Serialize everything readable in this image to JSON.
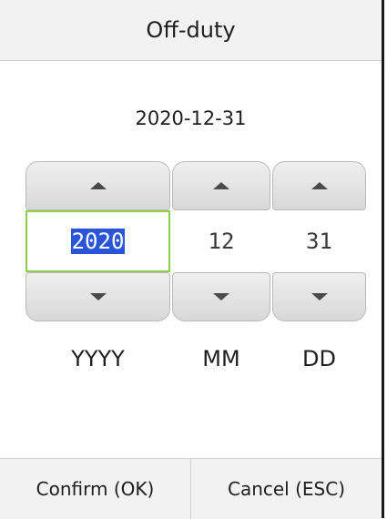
{
  "dialog": {
    "title": "Off-duty",
    "date_readout": "2020-12-31"
  },
  "picker": {
    "year": {
      "value": "2020",
      "label": "YYYY",
      "selected": true
    },
    "month": {
      "value": "12",
      "label": "MM"
    },
    "day": {
      "value": "31",
      "label": "DD"
    }
  },
  "footer": {
    "confirm_label": "Confirm (OK)",
    "cancel_label": "Cancel (ESC)"
  },
  "icons": {
    "up": "triangle-up-icon",
    "down": "triangle-down-icon"
  },
  "colors": {
    "focus_border": "#8fce4a",
    "selection_bg": "#2b55d9"
  }
}
